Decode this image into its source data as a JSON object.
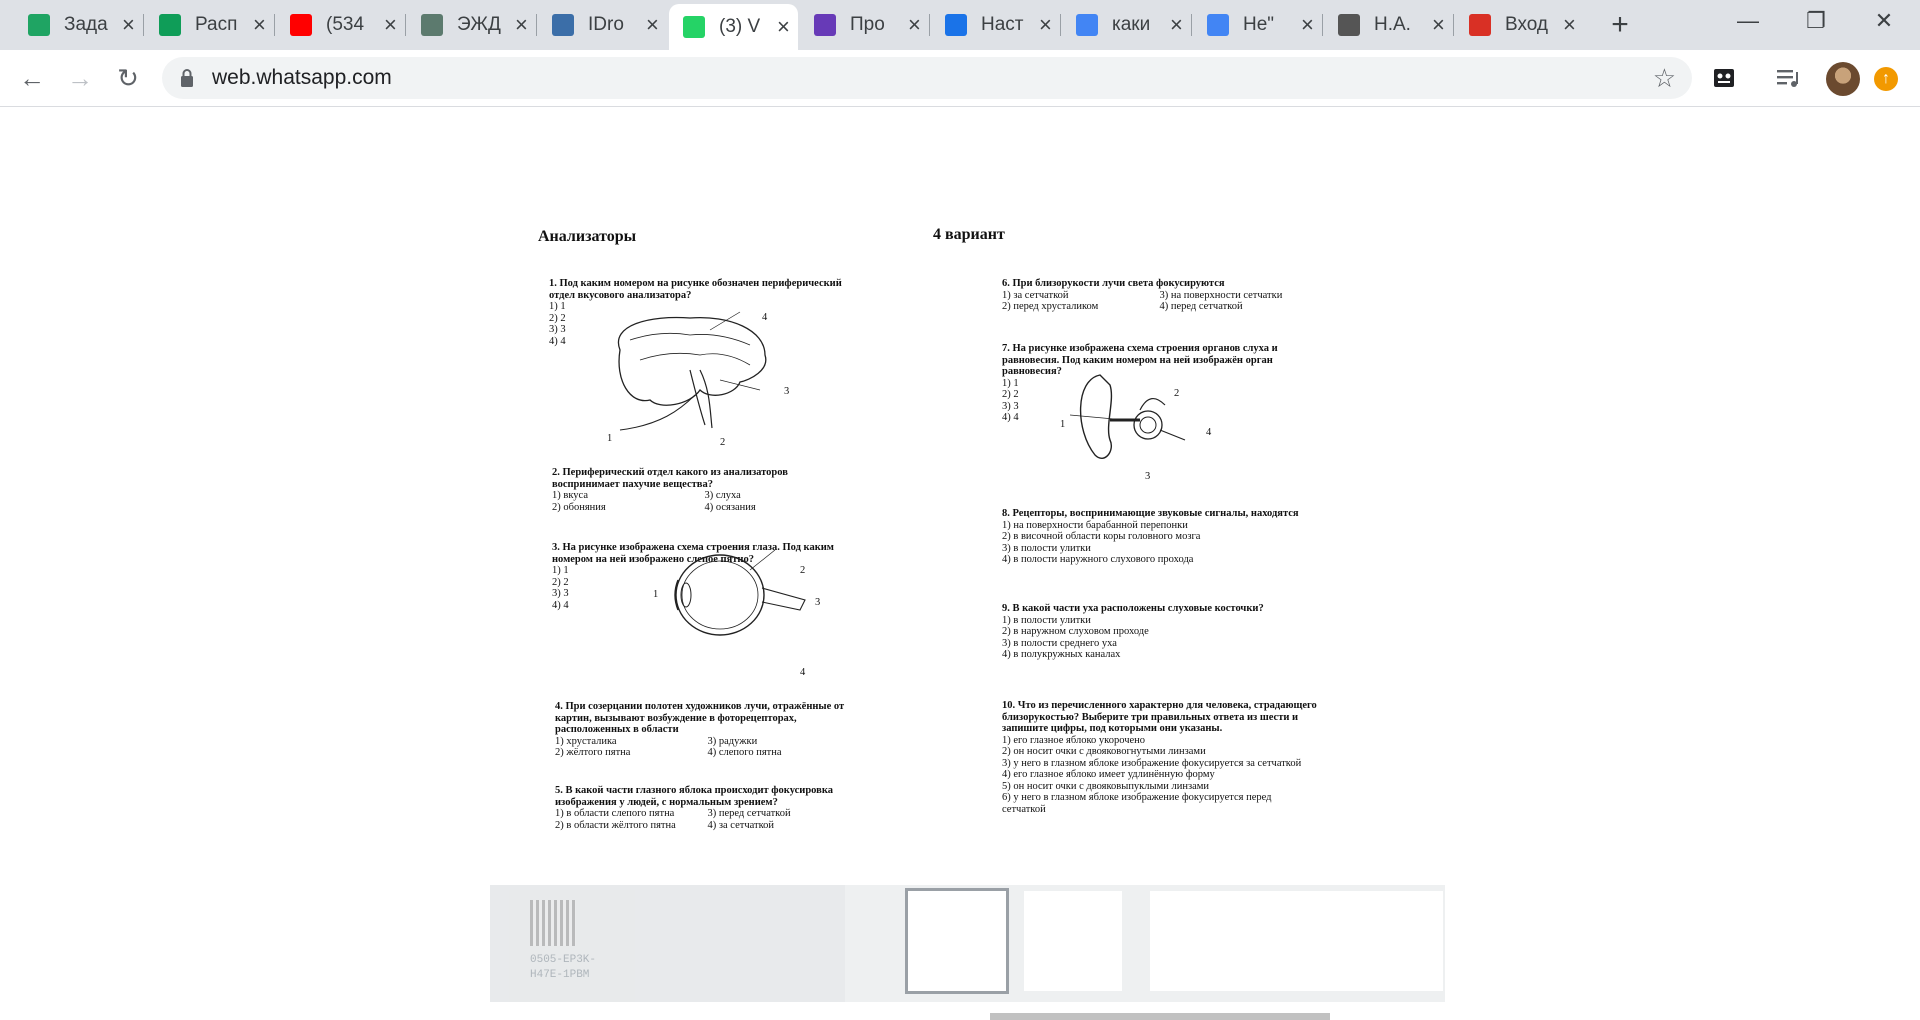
{
  "tabs": [
    {
      "title": "Зада",
      "icon": "google-drive-icon",
      "color": "#1fa463",
      "active": false
    },
    {
      "title": "Расп",
      "icon": "google-sheets-icon",
      "color": "#0f9d58",
      "active": false
    },
    {
      "title": "(534",
      "icon": "youtube-icon",
      "color": "#ff0000",
      "active": false
    },
    {
      "title": "ЭЖД",
      "icon": "document-icon",
      "color": "#5c7a6e",
      "active": false
    },
    {
      "title": "IDro",
      "icon": "idroo-icon",
      "color": "#3b6ea8",
      "active": false
    },
    {
      "title": "(3) V",
      "icon": "whatsapp-icon",
      "color": "#25d366",
      "active": true
    },
    {
      "title": "Про",
      "icon": "google-forms-icon",
      "color": "#673ab7",
      "active": false
    },
    {
      "title": "Наст",
      "icon": "settings-gear-icon",
      "color": "#1a73e8",
      "active": false
    },
    {
      "title": "каки",
      "icon": "google-g-icon",
      "color": "#4285f4",
      "active": false
    },
    {
      "title": "Не\"",
      "icon": "google-g-icon",
      "color": "#4285f4",
      "active": false
    },
    {
      "title": "Н.А.",
      "icon": "image-icon",
      "color": "#555555",
      "active": false
    },
    {
      "title": "Вход",
      "icon": "gmail-icon",
      "color": "#d93025",
      "active": false
    }
  ],
  "toolbar": {
    "url": "web.whatsapp.com"
  },
  "document": {
    "title_left": "Анализаторы",
    "title_right": "4 вариант",
    "questions_left": [
      {
        "num": "1.",
        "text": "Под каким номером на рисунке обозначен периферический отдел вкусового анализатора?",
        "options": [
          "1) 1",
          "2) 2",
          "3) 3",
          "4) 4"
        ]
      },
      {
        "num": "2.",
        "text": "Периферический отдел какого из анализаторов воспринимает пахучие вещества?",
        "options": [
          "1) вкуса",
          "3) слуха",
          "2) обоняния",
          "4) осязания"
        ]
      },
      {
        "num": "3.",
        "text": "На рисунке изображена схема строения глаза. Под каким номером на ней изображено слепое пятно?",
        "options": [
          "1) 1",
          "2) 2",
          "3) 3",
          "4) 4"
        ]
      },
      {
        "num": "4.",
        "text": "При созерцании полотен художников лучи, отражённые от картин, вызывают возбуждение в фоторецепторах, расположенных в области",
        "options": [
          "1) хрусталика",
          "3) радужки",
          "2) жёлтого пятна",
          "4) слепого пятна"
        ]
      },
      {
        "num": "5.",
        "text": "В какой части глазного яблока происходит фокусировка изображения у людей, с нормальным зрением?",
        "options": [
          "1) в области слепого пятна",
          "3) перед сетчаткой",
          "2) в области жёлтого пятна",
          "4) за сетчаткой"
        ]
      }
    ],
    "questions_right": [
      {
        "num": "6.",
        "text": "При близорукости лучи света фокусируются",
        "options": [
          "1) за сетчаткой",
          "3) на поверхности сетчатки",
          "2) перед хрусталиком",
          "4) перед сетчаткой"
        ]
      },
      {
        "num": "7.",
        "text": "На рисунке изображена схема строения органов слуха и равновесия. Под каким номером на ней изображён орган равновесия?",
        "options": [
          "1) 1",
          "2) 2",
          "3) 3",
          "4) 4"
        ]
      },
      {
        "num": "8.",
        "text": "Рецепторы, воспринимающие звуковые сигналы, находятся",
        "options": [
          "1) на поверхности барабанной перепонки",
          "2) в височной области коры головного мозга",
          "3) в полости улитки",
          "4) в полости наружного слухового прохода"
        ]
      },
      {
        "num": "9.",
        "text": "В какой части уха расположены слуховые косточки?",
        "options": [
          "1) в полости улитки",
          "2) в наружном слуховом проходе",
          "3) в полости среднего уха",
          "4) в полукружных каналах"
        ]
      },
      {
        "num": "10.",
        "text": "Что из перечисленного характерно для человека, страдающего близорукостью? Выберите три правильных ответа из шести и запишите цифры, под которыми они указаны.",
        "options": [
          "1) его глазное яблоко укорочено",
          "2) он носит очки с двояковогнутыми линзами",
          "3) у него в глазном яблоке изображение фокусируется за сетчаткой",
          "4) его глазное яблоко имеет удлинённую форму",
          "5) он носит очки с двояковыпуклыми линзами",
          "6) у него в глазном яблоке изображение фокусируется перед сетчаткой"
        ]
      }
    ],
    "figure_labels": {
      "brain": [
        "1",
        "2",
        "3",
        "4"
      ],
      "eye": [
        "1",
        "2",
        "3",
        "4"
      ],
      "ear": [
        "1",
        "2",
        "3",
        "4"
      ]
    }
  },
  "strip": {
    "qr_code": "0505-EP3K-H47E-1PBM"
  }
}
